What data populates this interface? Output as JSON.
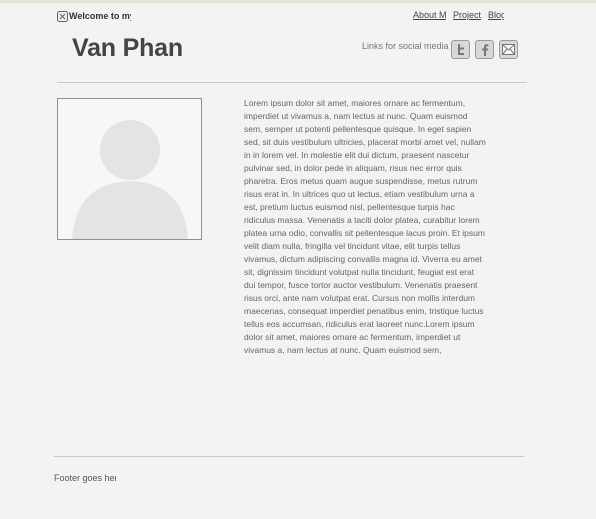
{
  "header": {
    "welcome_text": "Welcome to my",
    "nav": [
      {
        "label": "About M"
      },
      {
        "label": "Project"
      },
      {
        "label": "Blog"
      }
    ]
  },
  "profile": {
    "name": "Van Phan"
  },
  "social": {
    "label": "Links for social media",
    "icons": [
      "twitter-icon",
      "facebook-icon",
      "mail-icon"
    ]
  },
  "bio": {
    "text": "Lorem ipsum dolor sit amet, maiores ornare ac fermentum, imperdiet ut vivamus a, nam lectus at nunc. Quam euismod sem, semper ut potenti pellentesque quisque. In eget sapien sed, sit duis vestibulum ultricies, placerat morbi amet vel, nullam in in lorem vel. In molestie elit dui dictum, praesent nascetur pulvinar sed, in dolor pede in aliquam, risus nec error quis pharetra. Eros metus quam augue suspendisse, metus rutrum risus erat in. In ultrices quo ut lectus, etiam vestibulum urna a est, pretium luctus euismod nisl, pellentesque turpis hac ridiculus massa. Venenatis a taciti dolor platea, curabitur lorem platea urna odio, convallis sit pellentesque lacus proin. Et ipsum velit diam nulla, fringilla vel tincidunt vitae, elit turpis tellus vivamus, dictum adipiscing convallis magna id. Viverra eu amet sit, dignissim tincidunt volutpat nulla tincidunt, feugiat est erat dui tempor, fusce tortor auctor vestibulum. Venenatis praesent risus orci, ante nam volutpat erat. Cursus non mollis interdum maecenas, consequat imperdiet penatibus enim, tristique luctus tellus eos accumsan, ridiculus erat laoreet nunc.Lorem ipsum dolor sit amet, maiores ornare ac fermentum, imperdiet ut vivamus a, nam lectus at nunc. Quam euismod sem,"
  },
  "footer": {
    "text": "Footer goes here"
  }
}
